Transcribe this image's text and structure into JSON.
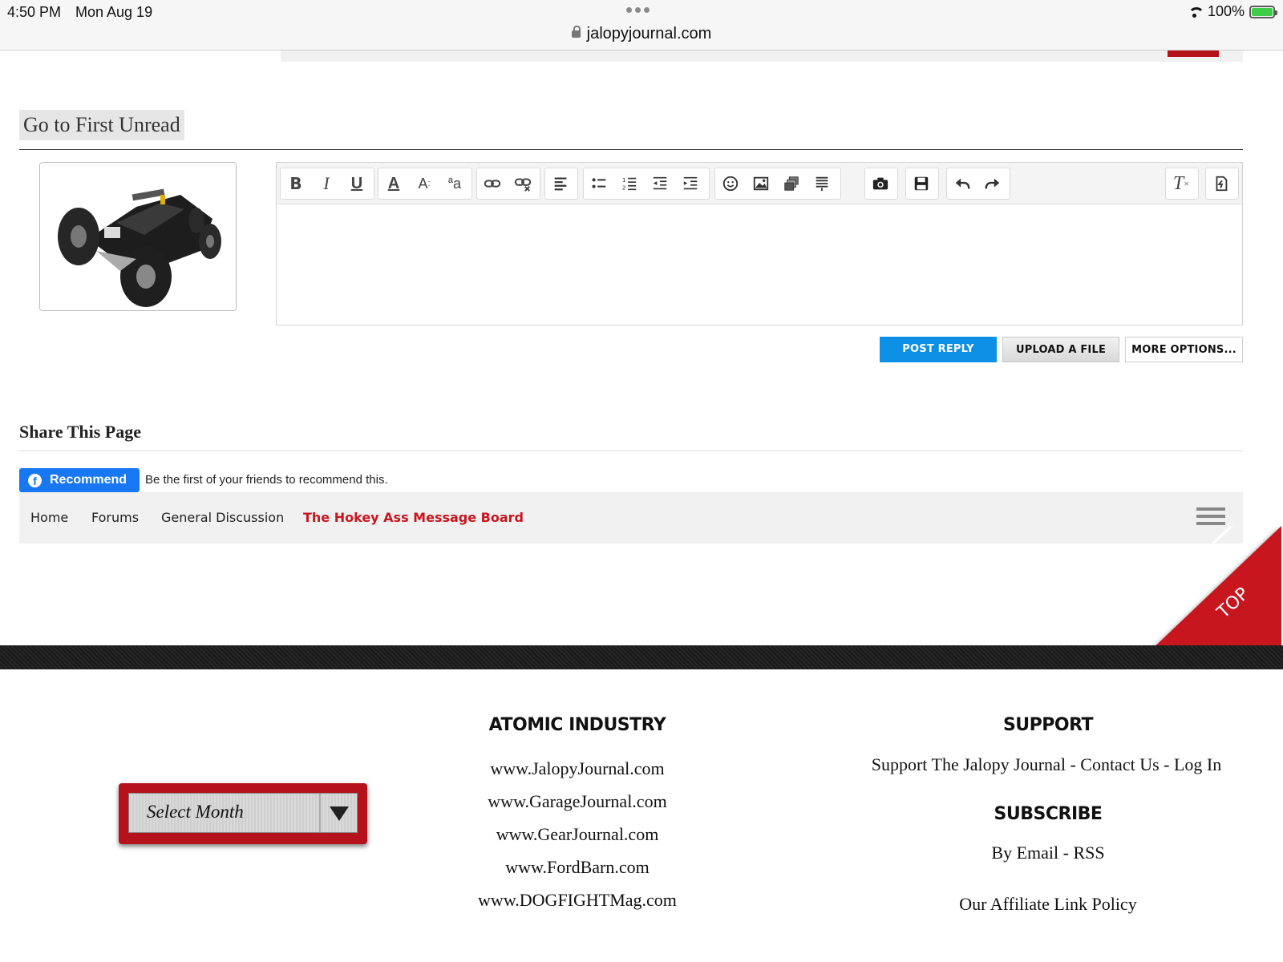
{
  "status_bar": {
    "time": "4:50 PM",
    "date": "Mon Aug 19",
    "url": "jalopyjournal.com",
    "battery": "100%"
  },
  "thread": {
    "go_first_unread": "Go to First Unread"
  },
  "editor": {
    "toolbar_icons": [
      "bold-icon",
      "italic-icon",
      "underline-icon",
      "text-color-icon",
      "font-size-icon",
      "font-family-icon",
      "link-icon",
      "unlink-icon",
      "align-icon",
      "bullet-list-icon",
      "numbered-list-icon",
      "outdent-icon",
      "indent-icon",
      "smilie-icon",
      "image-icon",
      "media-icon",
      "quote-icon",
      "camera-icon",
      "save-draft-icon",
      "undo-icon",
      "redo-icon",
      "remove-format-icon",
      "toggle-bbcode-icon"
    ]
  },
  "actions": {
    "post_reply": "POST REPLY",
    "upload_file": "UPLOAD A FILE",
    "more_options": "MORE OPTIONS..."
  },
  "share": {
    "title": "Share This Page",
    "fb_button": "Recommend",
    "fb_text": "Be the first of your friends to recommend this."
  },
  "breadcrumb": {
    "items": [
      "Home",
      "Forums",
      "General Discussion",
      "The Hokey Ass Message Board"
    ]
  },
  "top_button": "TOP",
  "footer": {
    "archive_select": "Select Month",
    "atomic_title": "ATOMIC INDUSTRY",
    "atomic_links": [
      "www.JalopyJournal.com",
      "www.GarageJournal.com",
      "www.GearJournal.com",
      "www.FordBarn.com",
      "www.DOGFIGHTMag.com"
    ],
    "support_title": "SUPPORT",
    "support_links": [
      "Support The Jalopy Journal",
      "Contact Us",
      "Log In"
    ],
    "subscribe_title": "SUBSCRIBE",
    "subscribe_links": [
      "By Email",
      "RSS"
    ],
    "separator": "-",
    "affiliate": "Our Affiliate Link Policy"
  },
  "colors": {
    "brand_red": "#c8161e",
    "post_blue": "#0c8fe5",
    "facebook_blue": "#1877f2"
  }
}
